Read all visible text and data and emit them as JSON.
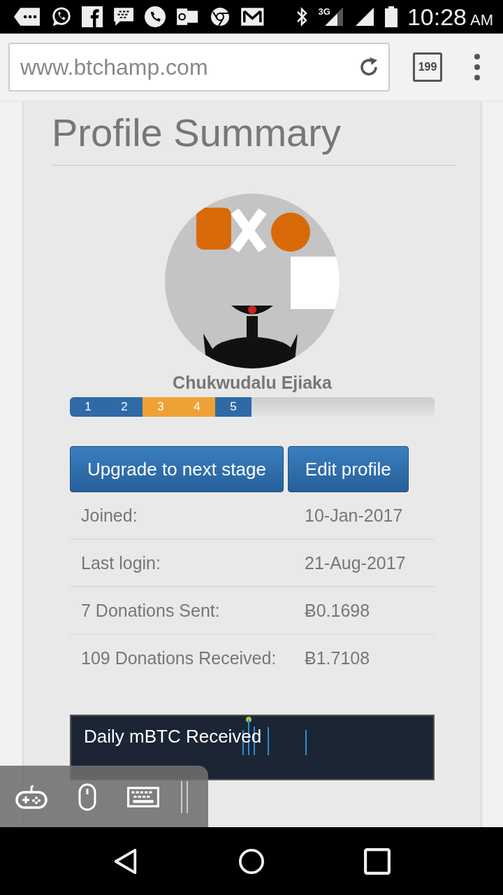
{
  "status_bar": {
    "network": "3G",
    "time": "10:28",
    "ampm": "AM"
  },
  "browser": {
    "url": "www.btchamp.com",
    "tab_count": "199"
  },
  "profile": {
    "title": "Profile Summary",
    "name": "Chukwudalu Ejiaka",
    "stages": [
      {
        "label": "1",
        "color": "#2f6aa6"
      },
      {
        "label": "2",
        "color": "#2f6aa6"
      },
      {
        "label": "3",
        "color": "#eea236"
      },
      {
        "label": "4",
        "color": "#eea236"
      },
      {
        "label": "5",
        "color": "#2f6aa6"
      }
    ],
    "buttons": [
      "Upgrade to next stage",
      "Edit profile"
    ],
    "rows": [
      {
        "label": "Joined:",
        "value": "10-Jan-2017"
      },
      {
        "label": "Last login:",
        "value": "21-Aug-2017"
      },
      {
        "label": "7 Donations Sent:",
        "value": "Ƀ0.1698"
      },
      {
        "label": "109 Donations Received:",
        "value": "Ƀ1.7108"
      }
    ],
    "chart_title": "Daily mBTC Received"
  }
}
